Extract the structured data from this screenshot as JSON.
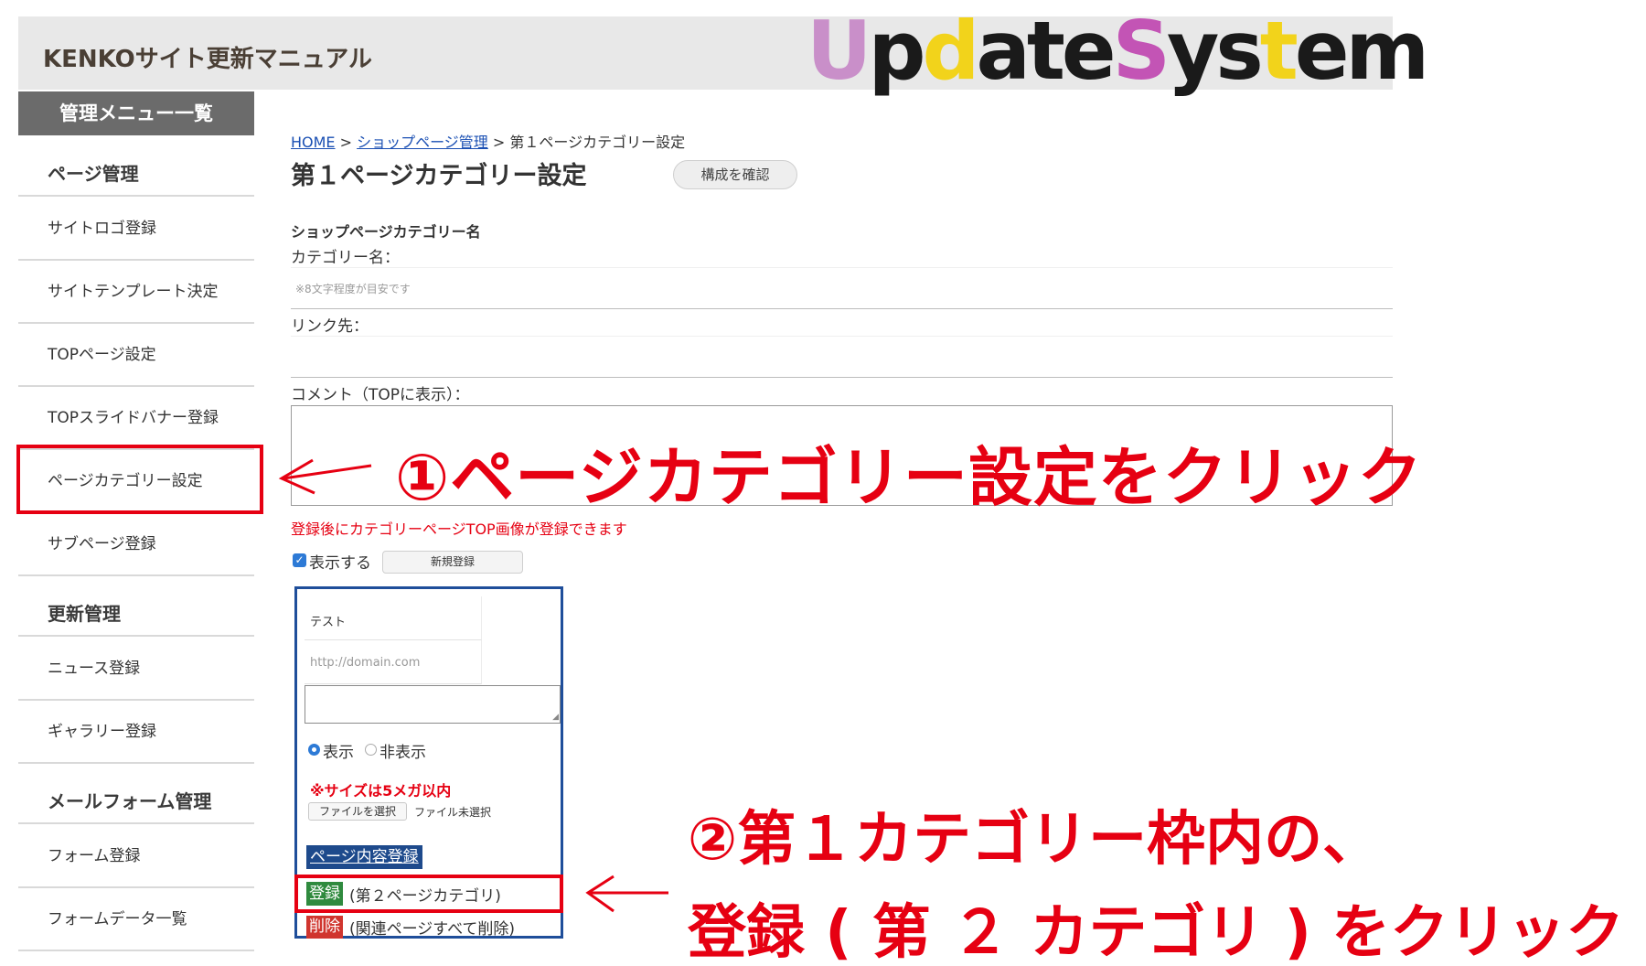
{
  "header": {
    "title": "KENKOサイト更新マニュアル",
    "logo": [
      "U",
      "p",
      "d",
      "a",
      "te",
      "S",
      "ys",
      "t",
      "em"
    ],
    "logo_colors": [
      "#c98fc9",
      "#1a1a1a",
      "#f2d31b",
      "#1a1a1a",
      "#1a1a1a",
      "#c354b5",
      "#1a1a1a",
      "#f2d31b",
      "#1a1a1a"
    ]
  },
  "sidebar": {
    "heading": "管理メニュー一覧",
    "sections": [
      {
        "title": "ページ管理",
        "items": [
          "サイトロゴ登録",
          "サイトテンプレート決定",
          "TOPページ設定",
          "TOPスライドバナー登録",
          "ページカテゴリー設定",
          "サブページ登録"
        ]
      },
      {
        "title": "更新管理",
        "items": [
          "ニュース登録",
          "ギャラリー登録"
        ]
      },
      {
        "title": "メールフォーム管理",
        "items": [
          "フォーム登録",
          "フォームデータ一覧"
        ]
      }
    ]
  },
  "breadcrumb": {
    "home": "HOME",
    "sep1": " > ",
    "shop": "ショップページ管理",
    "sep2": " > ",
    "current": "第１ページカテゴリー設定"
  },
  "page": {
    "title": "第１ページカテゴリー設定",
    "confirm_button": "構成を確認",
    "section_label": "ショップページカテゴリー名",
    "category_label": "カテゴリー名：",
    "category_placeholder": "※8文字程度が目安です",
    "link_label": "リンク先：",
    "link_value": "",
    "comment_label": "コメント（TOPに表示）：",
    "comment_value": "",
    "note": "登録後にカテゴリーページTOP画像が登録できます",
    "show_checkbox_label": "表示する",
    "show_checked": true,
    "new_button": "新規登録"
  },
  "category_box": {
    "name_value": "テスト",
    "url_placeholder": "http://domain.com",
    "radio_show": "表示",
    "radio_hide": "非表示",
    "radio_selected": "表示",
    "size_note": "※サイズは5メガ以内",
    "file_button": "ファイルを選択",
    "file_status": "ファイル未選択",
    "page_content_button": "ページ内容登録",
    "register_button": "登録",
    "register_text": "(第２ページカテゴリ)",
    "delete_button": "削除",
    "delete_text": "(関連ページすべて削除)"
  },
  "annotations": {
    "step1": "①ページカテゴリー設定をクリック",
    "step2_line1": "②第１カテゴリー枠内の、",
    "step2_line2": "登録 ( 第 ２ カテゴリ ) をクリック"
  },
  "colors": {
    "accent_red": "#e60012",
    "nav_blue": "#1e4a8c",
    "register_green": "#2f8a3e",
    "delete_red": "#d0352e",
    "box_border": "#1f4e9a"
  }
}
